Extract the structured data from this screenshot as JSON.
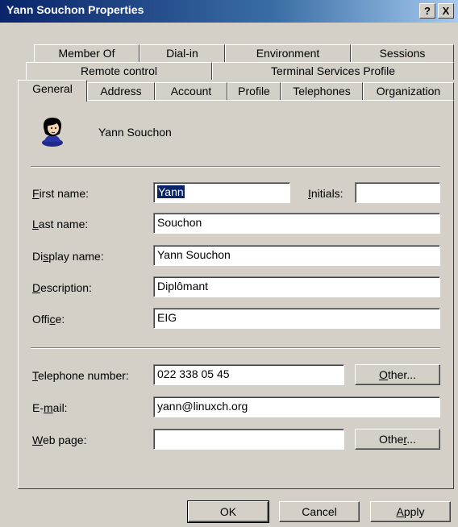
{
  "window": {
    "title": "Yann Souchon Properties",
    "help_label": "?",
    "close_label": "X"
  },
  "tabs_row1": [
    "Member Of",
    "Dial-in",
    "Environment",
    "Sessions"
  ],
  "tabs_row2": [
    "Remote control",
    "Terminal Services Profile"
  ],
  "tabs_row3": [
    "General",
    "Address",
    "Account",
    "Profile",
    "Telephones",
    "Organization"
  ],
  "active_tab": "General",
  "user": {
    "display": "Yann Souchon",
    "icon": "user-icon"
  },
  "fields": {
    "first_name": {
      "label": "First name:",
      "value": "Yann"
    },
    "initials": {
      "label": "Initials:",
      "value": ""
    },
    "last_name": {
      "label": "Last name:",
      "value": "Souchon"
    },
    "display_name": {
      "label": "Display name:",
      "value": "Yann Souchon"
    },
    "description": {
      "label": "Description:",
      "value": "Diplômant"
    },
    "office": {
      "label": "Office:",
      "value": "EIG"
    },
    "telephone": {
      "label": "Telephone number:",
      "value": "022 338 05 45"
    },
    "email": {
      "label": "E-mail:",
      "value": "yann@linuxch.org"
    },
    "web_page": {
      "label": "Web page:",
      "value": ""
    }
  },
  "buttons": {
    "other_phone": "Other...",
    "other_web": "Other...",
    "ok": "OK",
    "cancel": "Cancel",
    "apply": "Apply"
  }
}
